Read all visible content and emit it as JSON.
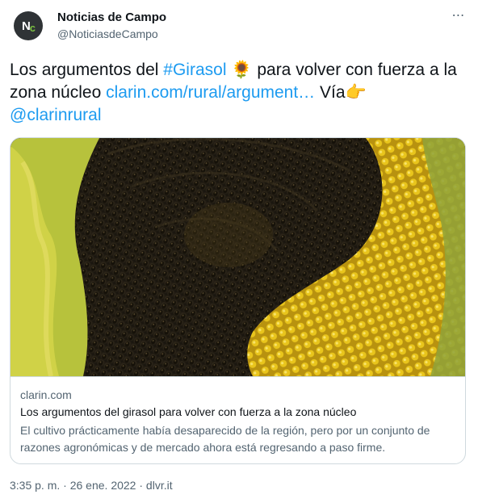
{
  "author": {
    "avatar_text_main": "N",
    "avatar_text_accent": "c",
    "name": "Noticias de Campo",
    "handle": "@NoticiasdeCampo"
  },
  "more_icon": "⋯",
  "tweet": {
    "text_1": "Los argumentos del ",
    "hashtag": "#Girasol",
    "emoji_sunflower": "🌻",
    "text_2": " para volver con fuerza a la zona núcleo ",
    "link": "clarin.com/rural/argument…",
    "text_3": " Vía",
    "emoji_pointer": "👉",
    "mention": "@clarinrural"
  },
  "card": {
    "image_subject": "sunflower-head",
    "domain": "clarin.com",
    "title": "Los argumentos del girasol para volver con fuerza a la zona núcleo",
    "description": "El cultivo prácticamente había desaparecido de la región, pero por un conjunto de razones agronómicas y de mercado ahora está regresando a paso firme."
  },
  "footer": {
    "time": "3:35 p. m.",
    "separator_1": " · ",
    "date": "26 ene. 2022",
    "separator_2": " · ",
    "source": "dlvr.it"
  },
  "colors": {
    "link": "#1d9bf0",
    "text": "#0f1419",
    "secondary": "#536471",
    "border": "#cfd9de"
  }
}
